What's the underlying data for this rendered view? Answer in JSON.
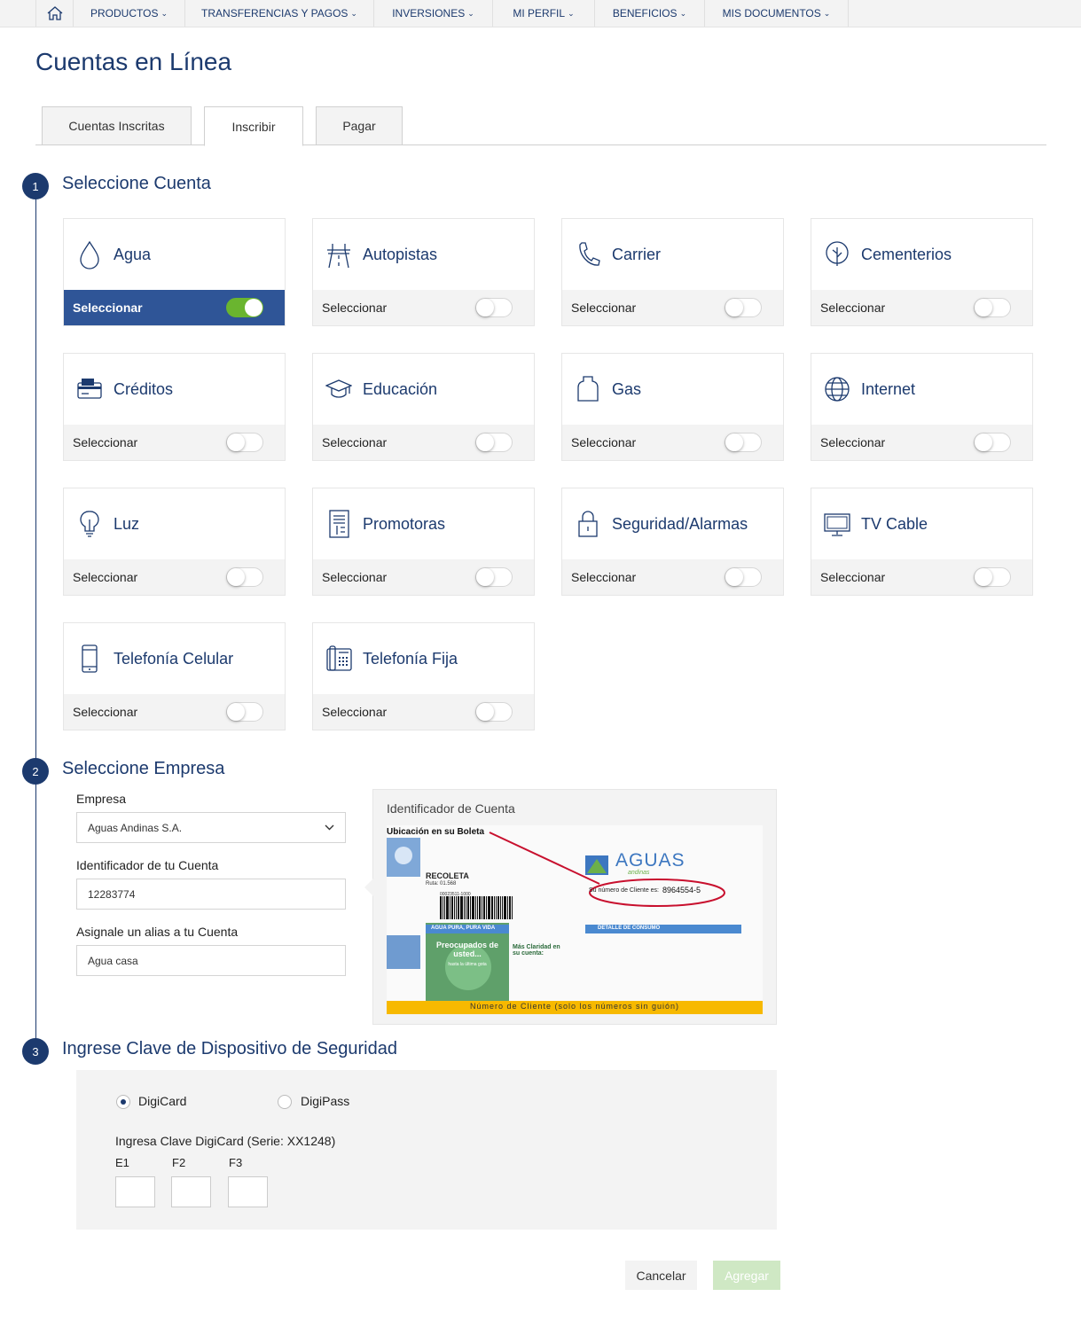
{
  "nav": {
    "home_icon": "home-icon",
    "items": [
      "PRODUCTOS",
      "TRANSFERENCIAS Y PAGOS",
      "INVERSIONES",
      "MI PERFIL",
      "BENEFICIOS",
      "MIS DOCUMENTOS"
    ]
  },
  "page": {
    "title": "Cuentas en Línea"
  },
  "tabs": [
    "Cuentas Inscritas",
    "Inscribir",
    "Pagar"
  ],
  "active_tab": "Inscribir",
  "step1": {
    "number": "1",
    "title": "Seleccione Cuenta",
    "select_label": "Seleccionar",
    "categories": [
      {
        "label": "Agua",
        "icon": "water-drop-icon",
        "selected": true
      },
      {
        "label": "Autopistas",
        "icon": "highway-icon",
        "selected": false
      },
      {
        "label": "Carrier",
        "icon": "phone-handset-icon",
        "selected": false
      },
      {
        "label": "Cementerios",
        "icon": "tree-icon",
        "selected": false
      },
      {
        "label": "Créditos",
        "icon": "credit-card-icon",
        "selected": false
      },
      {
        "label": "Educación",
        "icon": "graduation-cap-icon",
        "selected": false
      },
      {
        "label": "Gas",
        "icon": "gas-cylinder-icon",
        "selected": false
      },
      {
        "label": "Internet",
        "icon": "globe-icon",
        "selected": false
      },
      {
        "label": "Luz",
        "icon": "lightbulb-icon",
        "selected": false
      },
      {
        "label": "Promotoras",
        "icon": "document-icon",
        "selected": false
      },
      {
        "label": "Seguridad/Alarmas",
        "icon": "lock-icon",
        "selected": false
      },
      {
        "label": "TV Cable",
        "icon": "tv-monitor-icon",
        "selected": false
      },
      {
        "label": "Telefonía Celular",
        "icon": "mobile-phone-icon",
        "selected": false
      },
      {
        "label": "Telefonía Fija",
        "icon": "desk-phone-icon",
        "selected": false
      }
    ]
  },
  "step2": {
    "number": "2",
    "title": "Seleccione Empresa",
    "empresa_label": "Empresa",
    "empresa_value": "Aguas Andinas S.A.",
    "id_label": "Identificador de tu Cuenta",
    "id_value": "12283774",
    "alias_label": "Asignale un alias a tu Cuenta",
    "alias_value": "Agua casa",
    "id_box_title": "Identificador de Cuenta",
    "bill": {
      "location_text": "Ubicación en su Boleta",
      "brand": "AGUAS",
      "brand_sub": "andinas",
      "client_label": "Su número de Cliente es:",
      "client_number": "8964554-5",
      "comuna": "RECOLETA",
      "ruta": "Ruta: 01.568",
      "barcode_num": "00023511-1000",
      "left_band": "AGUA PURA, PURA VIDA",
      "right_band": "DETALLE DE CONSUMO",
      "promo_title": "Preocupados de usted...",
      "promo_sub": "hasta la última gota",
      "promo2": "Más Claridad en su cuenta:",
      "footer": "Número de Cliente (solo los números sin guión)"
    }
  },
  "step3": {
    "number": "3",
    "title": "Ingrese Clave de Dispositivo de Seguridad",
    "options": [
      "DigiCard",
      "DigiPass"
    ],
    "selected_option": "DigiCard",
    "prompt": "Ingresa Clave DigiCard (Serie: XX1248)",
    "coords": [
      "E1",
      "F2",
      "F3"
    ]
  },
  "actions": {
    "cancel": "Cancelar",
    "add": "Agregar"
  },
  "colors": {
    "primary": "#1c3a6e",
    "selected_card": "#2f5597",
    "toggle_on": "#6ab52f",
    "add_button": "#cfe8c4"
  }
}
